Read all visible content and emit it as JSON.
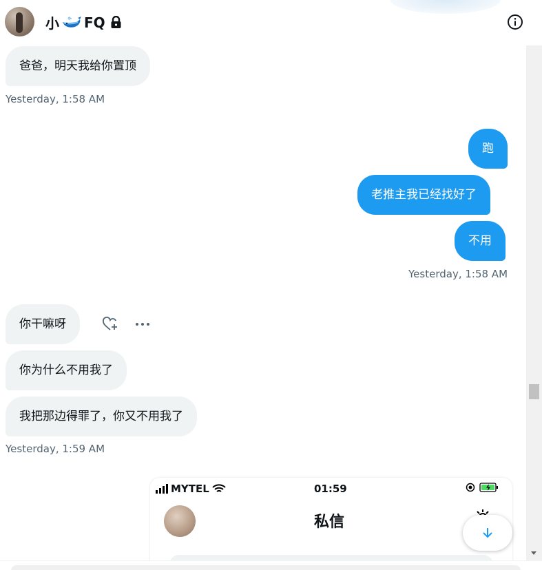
{
  "header": {
    "name_prefix": "小",
    "name_suffix": "FQ",
    "icons": {
      "whale": "whale-emoji-icon",
      "lock": "lock-icon",
      "info": "info-icon"
    }
  },
  "messages": [
    {
      "side": "in",
      "text": "爸爸，明天我给你置顶"
    },
    {
      "side": "out",
      "text": "跑"
    },
    {
      "side": "out",
      "text": "老推主我已经找好了"
    },
    {
      "side": "out",
      "text": "不用"
    },
    {
      "side": "in",
      "text": "你干嘛呀"
    },
    {
      "side": "in",
      "text": "你为什么不用我了"
    },
    {
      "side": "in",
      "text": "我把那边得罪了，你又不用我了"
    }
  ],
  "timestamps": {
    "t1": "Yesterday, 1:58 AM",
    "t2": "Yesterday, 1:58 AM",
    "t3": "Yesterday, 1:59 AM"
  },
  "embedded_screenshot": {
    "carrier": "MYTEL",
    "time": "01:59",
    "title": "私信"
  },
  "colors": {
    "accent": "#1d9bf0",
    "incoming_bubble": "#eff3f4",
    "meta_text": "#536471"
  }
}
